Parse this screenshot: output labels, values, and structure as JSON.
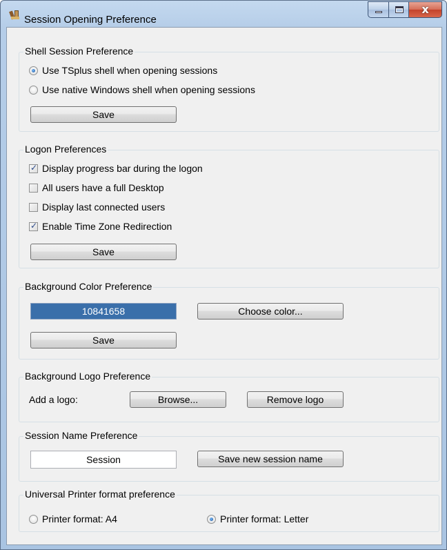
{
  "window": {
    "title": "Session Opening Preference",
    "app_icon": "tools-icon",
    "close_glyph": "x"
  },
  "shell": {
    "legend": "Shell Session Preference",
    "option_tsplus": "Use TSplus shell when opening sessions",
    "option_native": "Use native Windows shell when opening sessions",
    "selected": "tsplus",
    "save_label": "Save"
  },
  "logon": {
    "legend": "Logon Preferences",
    "options": [
      {
        "label": "Display progress bar during the logon",
        "checked": true
      },
      {
        "label": "All users have a full Desktop",
        "checked": false
      },
      {
        "label": "Display last connected users",
        "checked": false
      },
      {
        "label": "Enable Time Zone Redirection",
        "checked": true
      }
    ],
    "save_label": "Save"
  },
  "bgcolor": {
    "legend": "Background Color Preference",
    "value": "10841658",
    "swatch_color": "#3a6faa",
    "choose_label": "Choose color...",
    "save_label": "Save"
  },
  "logo": {
    "legend": "Background Logo Preference",
    "add_label": "Add a logo:",
    "browse_label": "Browse...",
    "remove_label": "Remove logo"
  },
  "session_name": {
    "legend": "Session Name Preference",
    "value": "Session",
    "save_label": "Save new session name"
  },
  "printer": {
    "legend": "Universal Printer format preference",
    "option_a4": "Printer format: A4",
    "option_letter": "Printer format: Letter",
    "selected": "letter"
  }
}
